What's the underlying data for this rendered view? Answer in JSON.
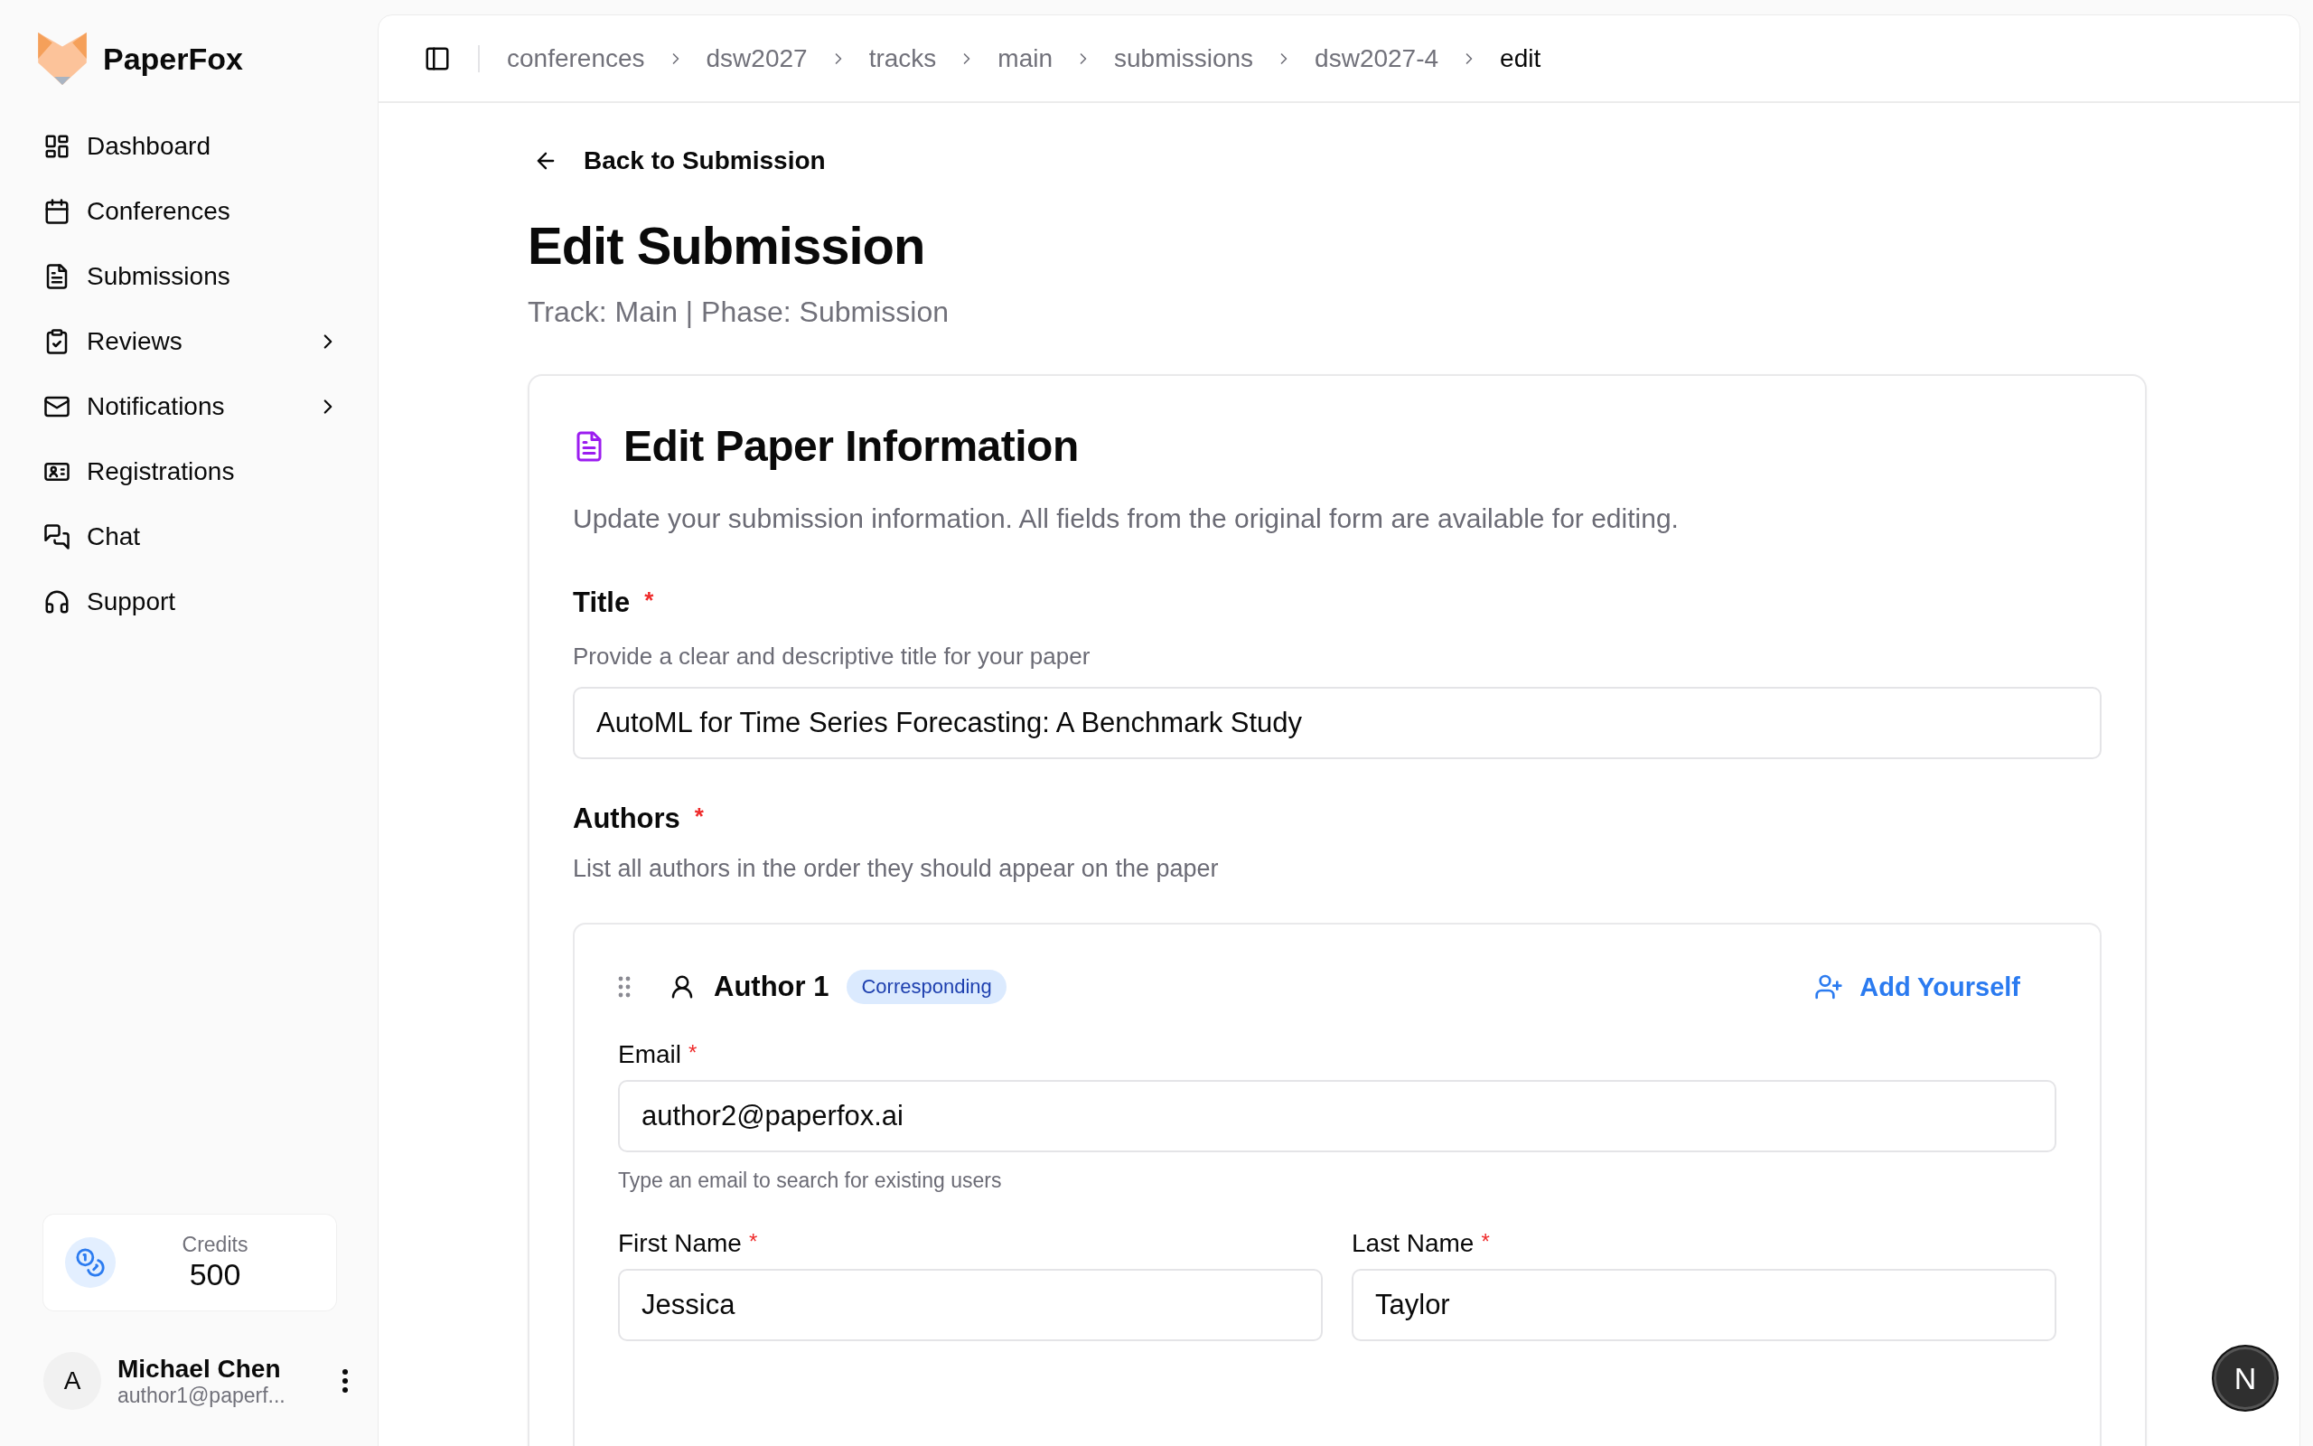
{
  "brand": {
    "name": "PaperFox"
  },
  "sidebar": {
    "items": [
      {
        "label": "Dashboard",
        "submenu": false
      },
      {
        "label": "Conferences",
        "submenu": false
      },
      {
        "label": "Submissions",
        "submenu": false
      },
      {
        "label": "Reviews",
        "submenu": true
      },
      {
        "label": "Notifications",
        "submenu": true
      },
      {
        "label": "Registrations",
        "submenu": false
      },
      {
        "label": "Chat",
        "submenu": false
      },
      {
        "label": "Support",
        "submenu": false
      }
    ],
    "credits": {
      "label": "Credits",
      "value": "500"
    },
    "user": {
      "initial": "A",
      "name": "Michael Chen",
      "email": "author1@paperf..."
    }
  },
  "breadcrumb": [
    {
      "label": "conferences",
      "current": false
    },
    {
      "label": "dsw2027",
      "current": false
    },
    {
      "label": "tracks",
      "current": false
    },
    {
      "label": "main",
      "current": false
    },
    {
      "label": "submissions",
      "current": false
    },
    {
      "label": "dsw2027-4",
      "current": false
    },
    {
      "label": "edit",
      "current": true
    }
  ],
  "back_link": "Back to Submission",
  "page_title": "Edit Submission",
  "page_subtitle": "Track: Main | Phase: Submission",
  "card": {
    "title": "Edit Paper Information",
    "description": "Update your submission information. All fields from the original form are available for editing.",
    "title_field": {
      "label": "Title",
      "required_mark": "*",
      "help": "Provide a clear and descriptive title for your paper",
      "value": "AutoML for Time Series Forecasting: A Benchmark Study"
    },
    "authors": {
      "label": "Authors",
      "required_mark": "*",
      "help": "List all authors in the order they should appear on the paper",
      "author": {
        "heading": "Author 1",
        "badge": "Corresponding",
        "add_button": "Add Yourself",
        "email": {
          "label": "Email",
          "required_mark": "*",
          "value": "author2@paperfox.ai",
          "hint": "Type an email to search for existing users"
        },
        "first_name": {
          "label": "First Name",
          "required_mark": "*",
          "value": "Jessica"
        },
        "last_name": {
          "label": "Last Name",
          "required_mark": "*",
          "value": "Taylor"
        }
      }
    }
  },
  "floating_button": "N"
}
